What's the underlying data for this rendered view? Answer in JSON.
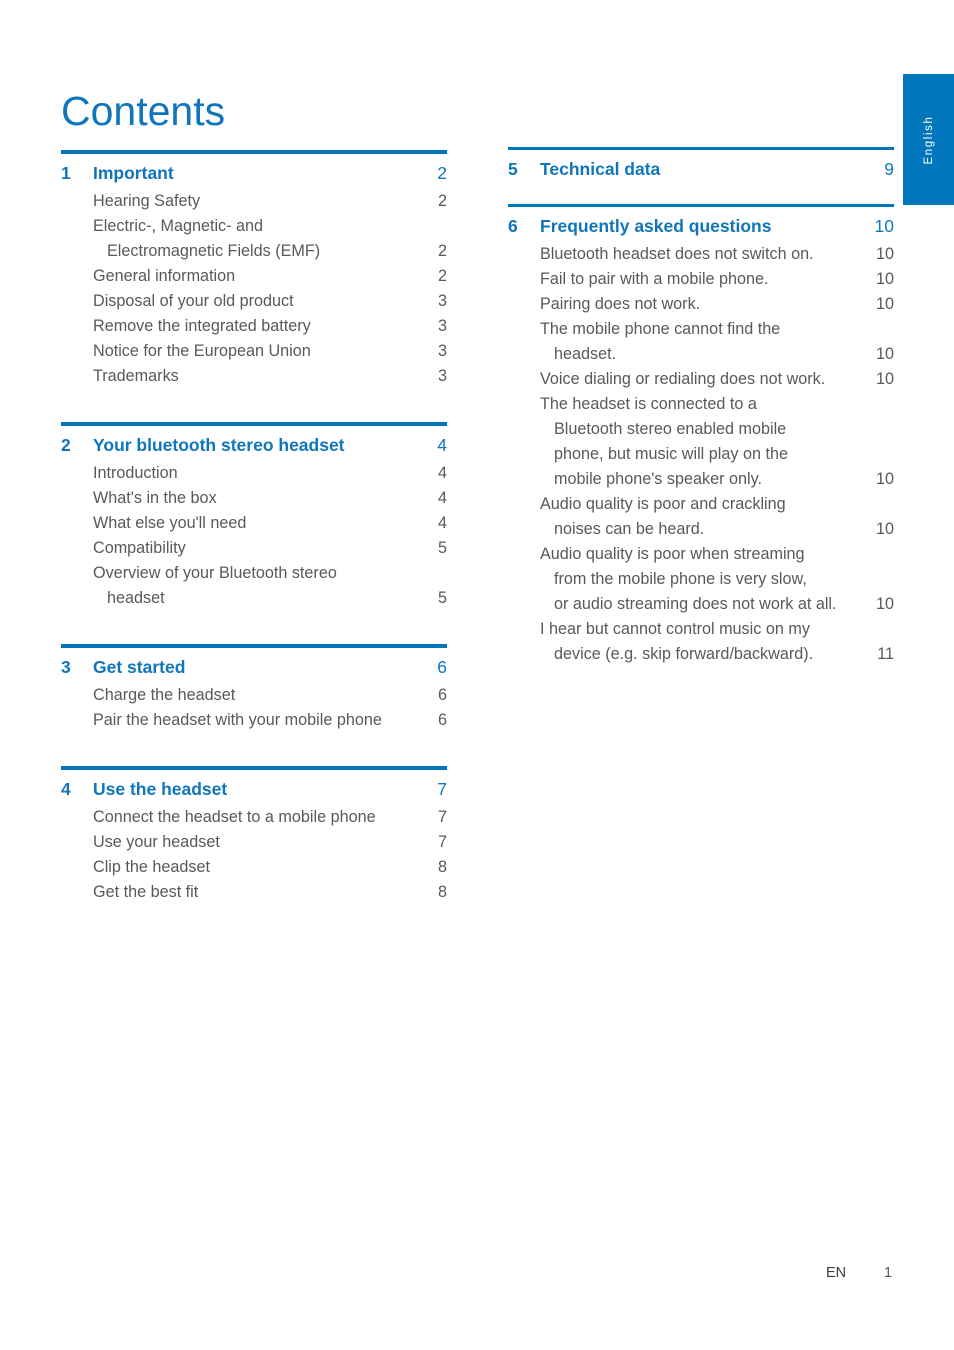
{
  "document": {
    "title": "Contents",
    "language_tab": "English",
    "footer": {
      "language_code": "EN",
      "page_number": "1"
    }
  },
  "columns": {
    "left": [
      {
        "number": "1",
        "title": "Important",
        "page": "2",
        "items": [
          {
            "label": "Hearing Safety",
            "page": "2",
            "indent": false
          },
          {
            "label": "Electric-, Magnetic- and",
            "page": "",
            "indent": false
          },
          {
            "label": "Electromagnetic Fields (EMF)",
            "page": "2",
            "indent": true
          },
          {
            "label": "General information",
            "page": "2",
            "indent": false
          },
          {
            "label": "Disposal of your old product",
            "page": "3",
            "indent": false
          },
          {
            "label": "Remove the integrated battery",
            "page": "3",
            "indent": false
          },
          {
            "label": "Notice for the European Union",
            "page": "3",
            "indent": false
          },
          {
            "label": "Trademarks",
            "page": "3",
            "indent": false
          }
        ]
      },
      {
        "number": "2",
        "title": "Your bluetooth stereo headset",
        "page": "4",
        "items": [
          {
            "label": "Introduction",
            "page": "4",
            "indent": false
          },
          {
            "label": "What's in the box",
            "page": "4",
            "indent": false
          },
          {
            "label": "What else you'll need",
            "page": "4",
            "indent": false
          },
          {
            "label": "Compatibility",
            "page": "5",
            "indent": false
          },
          {
            "label": "Overview of your Bluetooth stereo",
            "page": "",
            "indent": false
          },
          {
            "label": "headset",
            "page": "5",
            "indent": true
          }
        ]
      },
      {
        "number": "3",
        "title": "Get started",
        "page": "6",
        "items": [
          {
            "label": "Charge the headset",
            "page": "6",
            "indent": false
          },
          {
            "label": "Pair the headset with your mobile phone",
            "page": "6",
            "indent": false
          }
        ]
      },
      {
        "number": "4",
        "title": "Use the headset",
        "page": "7",
        "items": [
          {
            "label": "Connect the headset to a mobile phone",
            "page": "7",
            "indent": false
          },
          {
            "label": "Use your headset",
            "page": "7",
            "indent": false
          },
          {
            "label": "Clip the headset",
            "page": "8",
            "indent": false
          },
          {
            "label": "Get the best fit",
            "page": "8",
            "indent": false
          }
        ]
      }
    ],
    "right": [
      {
        "number": "5",
        "title": "Technical data",
        "page": "9",
        "items": []
      },
      {
        "number": "6",
        "title": "Frequently asked questions",
        "page": "10",
        "items": [
          {
            "label": "Bluetooth headset does not switch on.",
            "page": "10",
            "indent": false
          },
          {
            "label": "Fail to pair with a mobile phone.",
            "page": "10",
            "indent": false
          },
          {
            "label": "Pairing does not work.",
            "page": "10",
            "indent": false
          },
          {
            "label": "The mobile phone cannot find the",
            "page": "",
            "indent": false
          },
          {
            "label": "headset.",
            "page": "10",
            "indent": true
          },
          {
            "label": "Voice dialing or redialing does not work.",
            "page": "10",
            "indent": false
          },
          {
            "label": "The headset is connected to a",
            "page": "",
            "indent": false
          },
          {
            "label": "Bluetooth stereo enabled mobile",
            "page": "",
            "indent": true
          },
          {
            "label": "phone, but music will play on the",
            "page": "",
            "indent": true
          },
          {
            "label": "mobile phone's speaker only.",
            "page": "10",
            "indent": true
          },
          {
            "label": "Audio quality is poor and crackling",
            "page": "",
            "indent": false
          },
          {
            "label": "noises can be heard.",
            "page": "10",
            "indent": true
          },
          {
            "label": "Audio quality is poor when streaming",
            "page": "",
            "indent": false
          },
          {
            "label": "from the mobile phone is very slow,",
            "page": "",
            "indent": true
          },
          {
            "label": "or audio streaming does not work at all.",
            "page": "10",
            "indent": true,
            "tight": true
          },
          {
            "label": "I hear but cannot control music on my",
            "page": "",
            "indent": false
          },
          {
            "label": "device (e.g. skip forward/backward).",
            "page": "11",
            "indent": true
          }
        ]
      }
    ]
  },
  "colors": {
    "accent_blue": "#0077bd",
    "heading_blue": "#0f76bc",
    "body_gray": "#58595b"
  }
}
